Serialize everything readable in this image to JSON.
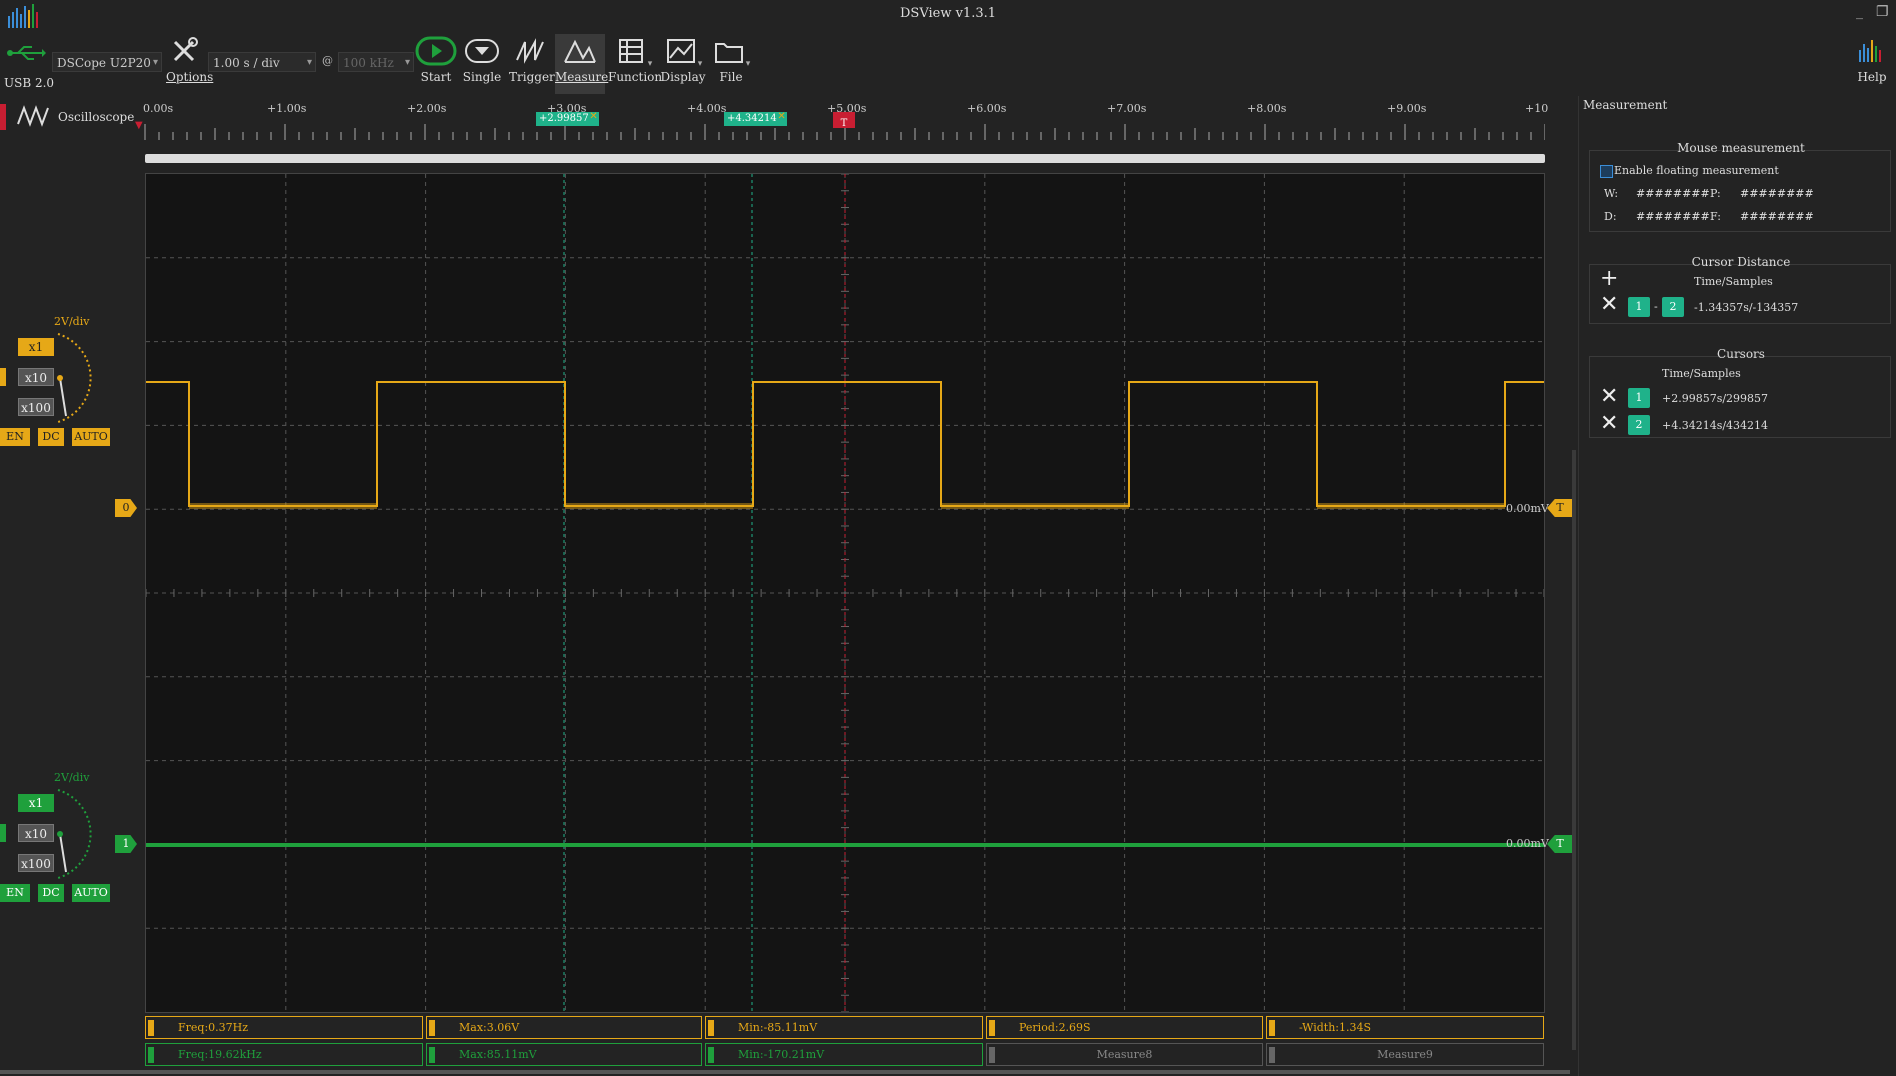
{
  "window": {
    "title": "DSView v1.3.1",
    "min": "_",
    "restore": "❐"
  },
  "toolbar": {
    "usb_label": "USB 2.0",
    "device": "DSCope U2P20",
    "timebase": "1.00 s / div",
    "at": "@",
    "samplerate": "100 kHz",
    "options": "Options",
    "start": "Start",
    "single": "Single",
    "trigger": "Trigger",
    "measure": "Measure",
    "function": "Function",
    "display": "Display",
    "file": "File",
    "help": "Help"
  },
  "mode": {
    "label": "Oscilloscope"
  },
  "ruler": {
    "ticks": [
      "0.00s",
      "+1.00s",
      "+2.00s",
      "+3.00s",
      "+4.00s",
      "+5.00s",
      "+6.00s",
      "+7.00s",
      "+8.00s",
      "+9.00s",
      "+10"
    ],
    "cursor1": "+2.99857",
    "cursor2": "+4.34214",
    "trigger_marker": "T"
  },
  "channels": [
    {
      "index": "0",
      "vdiv": "2V/div",
      "x1": "x1",
      "x10": "x10",
      "x100": "x100",
      "en": "EN",
      "dc": "DC",
      "auto": "AUTO",
      "offset": "0.00mV",
      "trig": "T",
      "color": "#e6a817"
    },
    {
      "index": "1",
      "vdiv": "2V/div",
      "x1": "x1",
      "x10": "x10",
      "x100": "x100",
      "en": "EN",
      "dc": "DC",
      "auto": "AUTO",
      "offset": "0.00mV",
      "trig": "T",
      "color": "#1fa03c"
    }
  ],
  "measurement_panel": {
    "title": "Measurement",
    "mouse": {
      "title": "Mouse measurement",
      "enable_label": "Enable floating measurement",
      "w_label": "W:",
      "w_value": "########",
      "p_label": "P:",
      "p_value": "########",
      "d_label": "D:",
      "d_value": "########",
      "f_label": "F:",
      "f_value": "########"
    },
    "cursor_distance": {
      "title": "Cursor Distance",
      "col": "Time/Samples",
      "a": "1",
      "sep": "-",
      "b": "2",
      "value": "-1.34357s/-134357"
    },
    "cursors": {
      "title": "Cursors",
      "col": "Time/Samples",
      "rows": [
        {
          "id": "1",
          "value": "+2.99857s/299857"
        },
        {
          "id": "2",
          "value": "+4.34214s/434214"
        }
      ]
    }
  },
  "measures_row1": [
    "Freq:0.37Hz",
    "Max:3.06V",
    "Min:-85.11mV",
    "Period:2.69S",
    "-Width:1.34S"
  ],
  "measures_row2": [
    "Freq:19.62kHz",
    "Max:85.11mV",
    "Min:-170.21mV",
    "Measure8",
    "Measure9"
  ],
  "colors": {
    "ch0": "#e6a817",
    "ch1": "#1fa03c",
    "cursor": "#1fb28a",
    "trigger": "#c81e32"
  }
}
